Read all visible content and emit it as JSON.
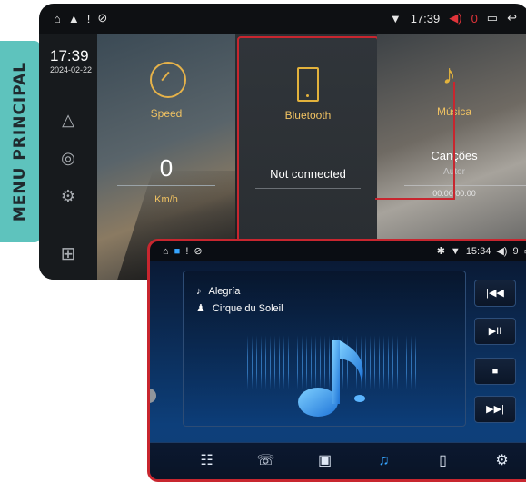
{
  "side_tab": {
    "label": "MENU PRINCIPAL"
  },
  "back_status": {
    "time": "17:39",
    "volume": "0"
  },
  "back_rail": {
    "clock": "17:39",
    "date": "2024-02-22"
  },
  "speed": {
    "label": "Speed",
    "value": "0",
    "unit": "Km/h"
  },
  "bluetooth": {
    "label": "Bluetooth",
    "status": "Not connected"
  },
  "music": {
    "label": "Música",
    "song": "Canções",
    "artist": "Autor",
    "time": "00:00/00:00"
  },
  "front_status": {
    "time": "15:34",
    "volume": "9"
  },
  "player": {
    "track": "Alegría",
    "artist": "Cirque du Soleil"
  },
  "controls": {
    "prev": "|◀◀",
    "play_pause": "▶II",
    "stop": "■",
    "next": "▶▶|"
  },
  "bottom_nav": [
    "apps-icon",
    "phone-icon",
    "contacts-icon",
    "music-icon",
    "phone-link-icon",
    "settings-icon"
  ],
  "colors": {
    "accent_red": "#c8262f",
    "tab_teal": "#5ec3bd",
    "gold": "#f0c262",
    "blue": "#36a5ff"
  }
}
